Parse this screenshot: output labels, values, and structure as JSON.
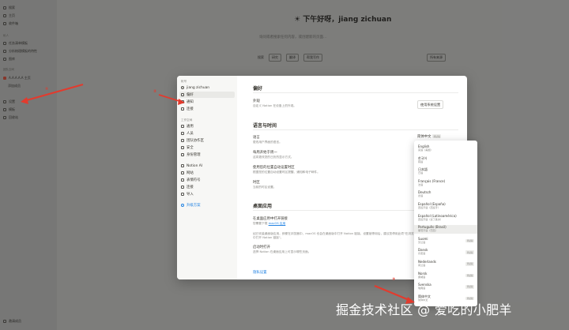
{
  "app_sidebar": {
    "items": [
      "搜索",
      "主页",
      "收件箱"
    ],
    "section_private": "私人",
    "private_items": [
      "任务清单模板",
      "分析梳理模板的特性",
      "图库"
    ],
    "section_workspace": "团队空间",
    "workspace_name": "A.A.A.A.A 主页",
    "workspace_sub": "添加成员",
    "footer_items": [
      "设置",
      "模板",
      "回收站"
    ],
    "bottom": "邀请成员"
  },
  "backdrop": {
    "greeting_icon": "☀",
    "greeting": "下午好呀，jiang zichuan",
    "greeting_sub": "询问或者搜索任何内容，或创建新的页面...",
    "toolbar_search": "搜索",
    "toolbar_items": [
      "研究",
      "翻译",
      "帮我写作"
    ],
    "toolbar_right": "所有来源"
  },
  "settings": {
    "account_label": "帐号",
    "user_name": "jiang zichuan",
    "account_items": [
      "偏好",
      "通知",
      "连接"
    ],
    "workspace_label": "工作空间",
    "workspace_items": [
      "通用",
      "人员",
      "团队协作区",
      "安全",
      "身份管理"
    ],
    "ai_label": "Notion AI",
    "ai_items": [
      "网站",
      "表情符号",
      "连接",
      "导入"
    ],
    "upgrade": "升级方案",
    "preferences_title": "偏好",
    "appearance_label": "外观",
    "appearance_desc": "自定义 Notion 在设备上的外观。",
    "appearance_value": "使用系统设置",
    "lang_time_title": "语言与时间",
    "language_label": "语言",
    "language_desc": "更改用户界面的语言。",
    "week_start_label": "每周开始于周一",
    "week_start_desc": "这将更改您的日历的显示方式。",
    "auto_tz_label": "使用您的位置自动设置时区",
    "auto_tz_desc": "根据您的位置自动设置时区提醒、通知和电子邮件。",
    "timezone_label": "时区",
    "timezone_desc": "当前的时区设置。",
    "desktop_title": "桌面应用",
    "open_links_label": "在桌面应用中打开链接",
    "open_links_desc_prefix": "您需要下载",
    "open_links_desc_link": "macOS 应用",
    "desktop_note": "如已安装桌面版应用，即便在浏览器中，macOS 也会在桌面版中打开 Notion 链接。设置被停用后，建议您停用此项\"在浏览器中打开 Notion 链接\"。",
    "open_startup_label": "启动时打开",
    "open_startup_desc": "选择 Notion 在桌面应用上可显示哪些页面。",
    "privacy_link": "隐私设置"
  },
  "language_dropdown": {
    "selected": "简体中文",
    "selected_badge": "测试版",
    "beta": "测试版",
    "options": [
      {
        "name": "English",
        "sub": "英语（美国）",
        "beta": false
      },
      {
        "name": "한국어",
        "sub": "韩语",
        "beta": false
      },
      {
        "name": "日本語",
        "sub": "日语",
        "beta": false
      },
      {
        "name": "Français (France)",
        "sub": "法语",
        "beta": false
      },
      {
        "name": "Deutsch",
        "sub": "德语",
        "beta": false
      },
      {
        "name": "Español (España)",
        "sub": "西班牙语（西班牙）",
        "beta": false
      },
      {
        "name": "Español (Latinoamérica)",
        "sub": "西班牙语（拉丁美洲）",
        "beta": false
      },
      {
        "name": "Português (Brasil)",
        "sub": "葡萄牙语（巴西）",
        "beta": false
      },
      {
        "name": "Suomi",
        "sub": "芬兰语",
        "beta": true
      },
      {
        "name": "Dansk",
        "sub": "丹麦语",
        "beta": true
      },
      {
        "name": "Nederlands",
        "sub": "荷兰语",
        "beta": true
      },
      {
        "name": "Norsk",
        "sub": "挪威语",
        "beta": true
      },
      {
        "name": "Svenska",
        "sub": "瑞典语",
        "beta": true
      },
      {
        "name": "简体中文",
        "sub": "简体中文",
        "beta": true
      }
    ]
  },
  "annotations": [
    "①",
    "②",
    "③"
  ],
  "watermark": "掘金技术社区 @ 爱吃的小肥羊",
  "colors": {
    "accent": "#2383e2",
    "arrow": "#e23b2e"
  }
}
